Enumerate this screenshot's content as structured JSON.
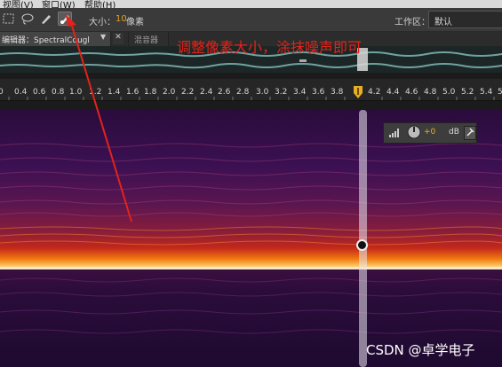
{
  "menubar": {
    "items": [
      "视图(V)",
      "窗口(W)",
      "帮助(H)"
    ]
  },
  "toolbar": {
    "tools": [
      {
        "icon": "marquee-select-icon",
        "active": false
      },
      {
        "icon": "lasso-select-icon",
        "active": false
      },
      {
        "icon": "brush-select-icon",
        "active": false
      },
      {
        "icon": "spot-healing-brush-icon",
        "active": true
      }
    ],
    "size_label": "大小：",
    "size_value": "10",
    "size_unit": "像素",
    "workspace_label": "工作区：",
    "workspace_value": "默认"
  },
  "tabs": {
    "editor_label": "编辑器：SpectralCough.wav *",
    "editor_menu_icon": "chevron-down-icon",
    "close_icon": "close-icon",
    "mixer_label": "混音器"
  },
  "ruler": {
    "labels": [
      "0.4",
      "0.6",
      "0.8",
      "1.0",
      "1.2",
      "1.4",
      "1.6",
      "1.8",
      "2.0",
      "2.2",
      "2.4",
      "2.6",
      "2.8",
      "3.0",
      "3.2",
      "3.4",
      "3.6",
      "3.8",
      "4.2",
      "4.4",
      "4.6",
      "4.8",
      "5.0",
      "5.2",
      "5.4"
    ],
    "partial_first": "0",
    "partial_last": "5"
  },
  "hud": {
    "value": "+0",
    "unit": "dB",
    "level_icon": "volume-bars-icon",
    "knob_icon": "volume-knob-icon",
    "pin_icon": "pin-icon"
  },
  "annotation": {
    "text": "调整像素大小，涂抹噪声即可",
    "color": "#e2231a"
  },
  "watermark": "CSDN @卓学电子"
}
